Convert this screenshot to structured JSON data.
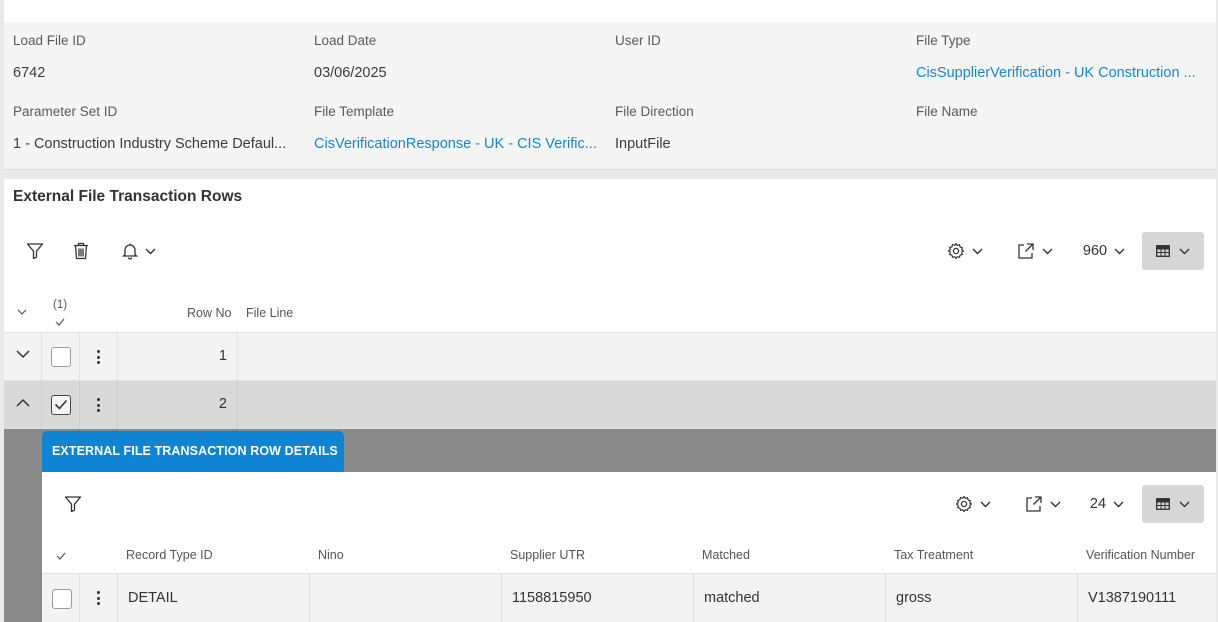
{
  "header": {
    "fields": [
      {
        "label": "Load File ID",
        "value": "6742"
      },
      {
        "label": "Load Date",
        "value": "03/06/2025"
      },
      {
        "label": "User ID",
        "value": ""
      },
      {
        "label": "File Type",
        "value": "CisSupplierVerification - UK Construction ..."
      },
      {
        "label": "Parameter Set ID",
        "value": "1 - Construction Industry Scheme Defaul..."
      },
      {
        "label": "File Template",
        "value": "CisVerificationResponse - UK - CIS Verific..."
      },
      {
        "label": "File Direction",
        "value": "InputFile"
      },
      {
        "label": "File Name",
        "value": ""
      }
    ]
  },
  "transactions": {
    "title": "External File Transaction Rows",
    "page_size": "960",
    "selected_count": "(1)",
    "columns": {
      "row_no": "Row No",
      "file_line": "File Line"
    },
    "rows": [
      {
        "row_no": "1",
        "file_line": "",
        "expanded": false,
        "selected": false
      },
      {
        "row_no": "2",
        "file_line": "",
        "expanded": true,
        "selected": true
      }
    ]
  },
  "details": {
    "tab_label": "EXTERNAL FILE TRANSACTION ROW DETAILS",
    "page_size": "24",
    "columns": [
      "Record Type ID",
      "Nino",
      "Supplier UTR",
      "Matched",
      "Tax Treatment",
      "Verification Number"
    ],
    "rows": [
      {
        "record_type_id": "DETAIL",
        "nino": "",
        "supplier_utr": "1158815950",
        "matched": "matched",
        "tax_treatment": "gross",
        "verification_number": "V1387190111"
      }
    ]
  },
  "colors": {
    "accent": "#0f84d2",
    "link": "#1a86c8",
    "selected_row": "#d9d9d9"
  }
}
